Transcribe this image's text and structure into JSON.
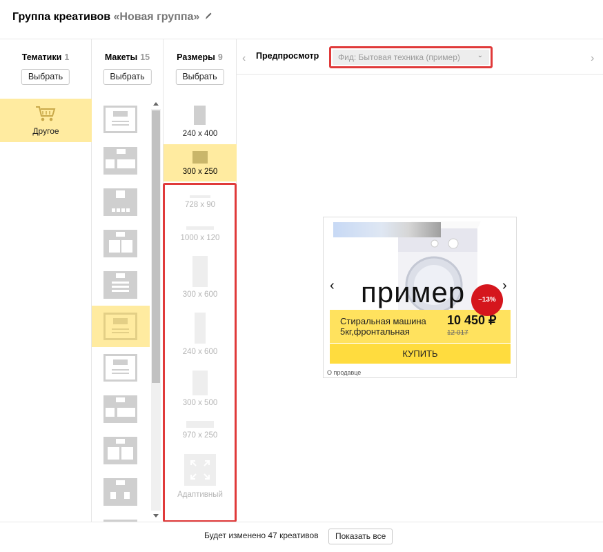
{
  "header": {
    "title": "Группа креативов",
    "group_name": "«Новая группа»"
  },
  "columns": {
    "themes": {
      "label": "Тематики",
      "count": "1",
      "button": "Выбрать"
    },
    "layouts": {
      "label": "Макеты",
      "count": "15",
      "button": "Выбрать"
    },
    "sizes": {
      "label": "Размеры",
      "count": "9",
      "button": "Выбрать"
    }
  },
  "themes": {
    "items": [
      {
        "label": "Другое",
        "icon": "cart-icon",
        "selected": true
      }
    ]
  },
  "sizes": {
    "items": [
      {
        "label": "240 x 400",
        "state": "enabled"
      },
      {
        "label": "300 x 250",
        "state": "selected"
      },
      {
        "label": "728 x 90",
        "state": "disabled"
      },
      {
        "label": "1000 x 120",
        "state": "disabled"
      },
      {
        "label": "300 x 600",
        "state": "disabled"
      },
      {
        "label": "240 x 600",
        "state": "disabled"
      },
      {
        "label": "300 x 500",
        "state": "disabled"
      },
      {
        "label": "970 x 250",
        "state": "disabled"
      },
      {
        "label": "Адаптивный",
        "state": "disabled"
      }
    ]
  },
  "preview": {
    "label": "Предпросмотр",
    "feed_value": "Фид: Бытовая техника (пример)",
    "prev_arrow": "‹",
    "next_arrow": "›"
  },
  "ad": {
    "headline": "пример",
    "discount": "–13%",
    "product_name": "Стиральная машина 5кг,фронтальная",
    "price": "10 450 ₽",
    "old_price": "12 017",
    "buy_button": "КУПИТЬ",
    "seller_link": "О продавце",
    "nav_left": "‹",
    "nav_right": "›"
  },
  "footer": {
    "status": "Будет изменено 47 креативов",
    "show_all_button": "Показать все"
  },
  "colors": {
    "selected_bg": "#ffeba0",
    "highlight_border": "#e03a3a",
    "discount_badge": "#d5161d",
    "price_panel": "#ffe25e",
    "buy_button": "#ffdc3e"
  }
}
